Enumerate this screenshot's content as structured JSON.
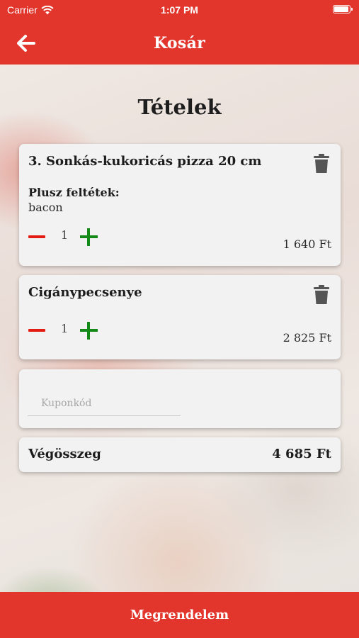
{
  "status_bar": {
    "carrier": "Carrier",
    "time": "1:07 PM",
    "battery_level": 1.0
  },
  "nav": {
    "title": "Kosár",
    "back_icon": "arrow-left-icon"
  },
  "section_title": "Tételek",
  "cart_items": [
    {
      "name": "3. Sonkás-kukoricás pizza 20 cm",
      "extras_label": "Plusz feltétek:",
      "extras": "bacon",
      "quantity": "1",
      "price": "1 640 Ft"
    },
    {
      "name": "Cigánypecsenye",
      "quantity": "1",
      "price": "2 825 Ft"
    }
  ],
  "coupon": {
    "placeholder": "Kuponkód",
    "value": ""
  },
  "total": {
    "label": "Végösszeg",
    "value": "4 685 Ft"
  },
  "order_button": "Megrendelem",
  "colors": {
    "brand_red": "#e2352c",
    "minus_red": "#e31b12",
    "plus_green": "#138a18"
  }
}
